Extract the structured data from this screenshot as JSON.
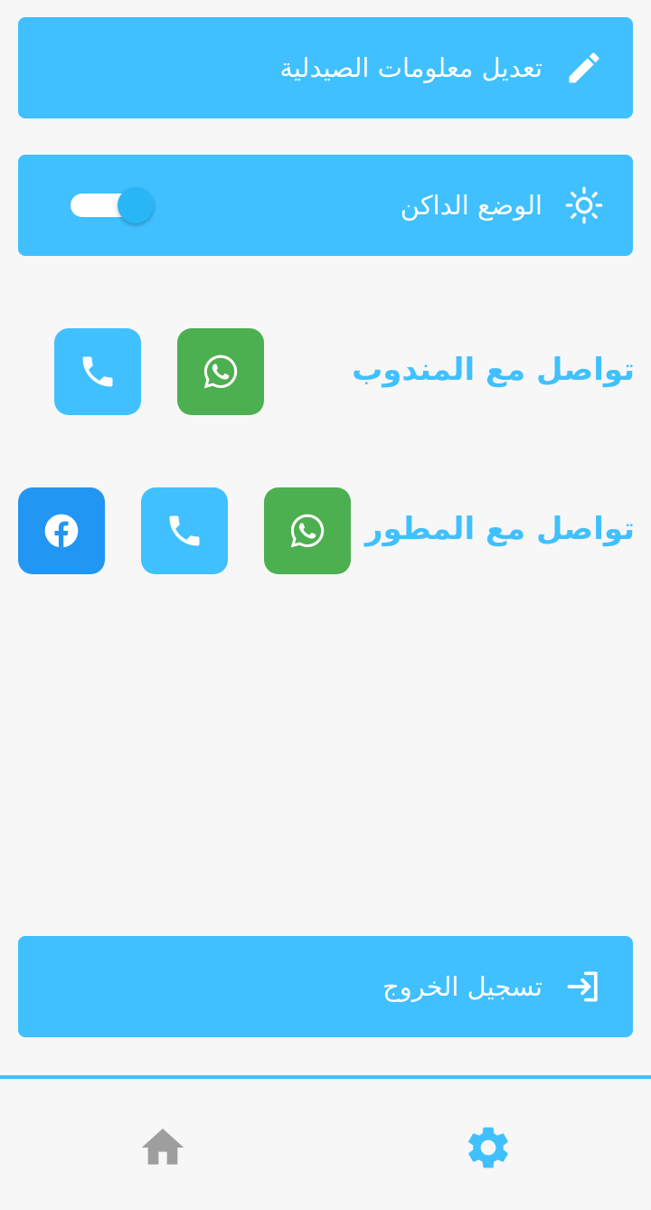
{
  "settings": {
    "edit_pharmacy": {
      "label": "تعديل معلومات الصيدلية",
      "icon": "pencil-icon"
    },
    "dark_mode": {
      "label": "الوضع الداكن",
      "icon": "sun-icon",
      "enabled": true
    }
  },
  "contacts": {
    "representative": {
      "title": "تواصل مع المندوب",
      "buttons": [
        "whatsapp",
        "phone"
      ]
    },
    "developer": {
      "title": "تواصل مع المطور",
      "buttons": [
        "whatsapp",
        "phone",
        "facebook"
      ]
    }
  },
  "logout": {
    "label": "تسجيل الخروج",
    "icon": "logout-icon"
  },
  "bottom_nav": {
    "items": [
      {
        "icon": "home-icon",
        "active": false
      },
      {
        "icon": "gear-icon",
        "active": true
      }
    ]
  },
  "colors": {
    "primary": "#40c0ff",
    "whatsapp": "#4caf50",
    "facebook": "#2196f3",
    "toggle_knob": "#29b6f6",
    "inactive_nav": "#9e9e9e"
  }
}
